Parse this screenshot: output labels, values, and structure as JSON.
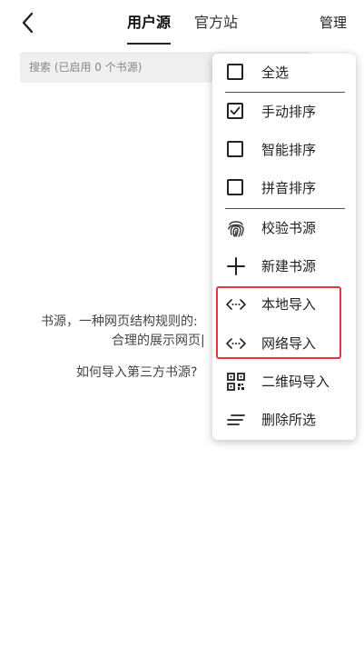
{
  "header": {
    "tabs": [
      {
        "label": "用户源"
      },
      {
        "label": "官方站"
      }
    ],
    "manage_label": "管理"
  },
  "search": {
    "placeholder": "搜索 (已启用 0 个书源)"
  },
  "empty": {
    "line1": "书源，一种网页结构规则的:",
    "line2": "合理的展示网页|",
    "line3": "如何导入第三方书源?"
  },
  "menu": {
    "items": [
      {
        "label": "全选",
        "icon": "checkbox-empty-icon",
        "checked": false
      },
      {
        "label": "手动排序",
        "icon": "checkbox-checked-icon",
        "checked": true
      },
      {
        "label": "智能排序",
        "icon": "checkbox-empty-icon",
        "checked": false
      },
      {
        "label": "拼音排序",
        "icon": "checkbox-empty-icon",
        "checked": false
      },
      {
        "label": "校验书源",
        "icon": "fingerprint-icon"
      },
      {
        "label": "新建书源",
        "icon": "plus-icon"
      },
      {
        "label": "本地导入",
        "icon": "code-icon"
      },
      {
        "label": "网络导入",
        "icon": "code-icon"
      },
      {
        "label": "二维码导入",
        "icon": "qr-code-icon"
      },
      {
        "label": "删除所选",
        "icon": "lines-icon"
      }
    ]
  },
  "colors": {
    "highlight": "#e53935",
    "search_bg": "#efefef"
  }
}
